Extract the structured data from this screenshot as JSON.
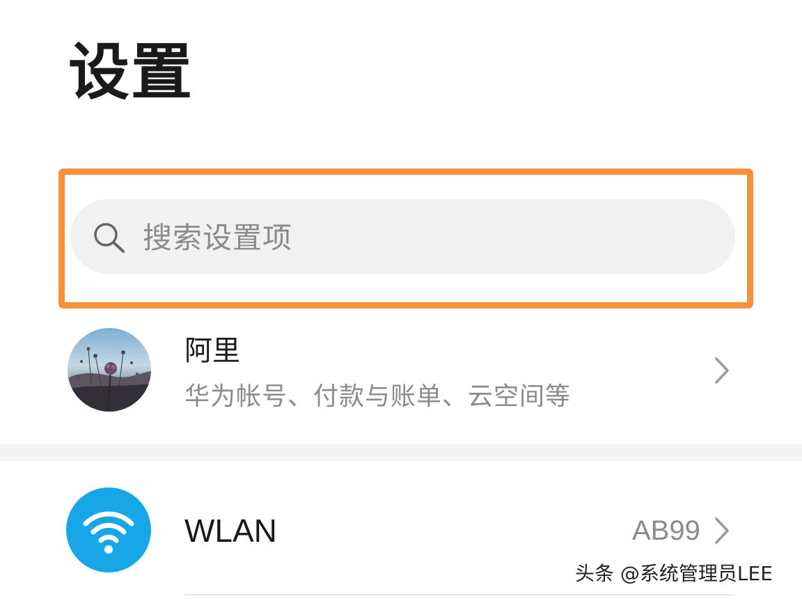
{
  "header": {
    "title": "设置"
  },
  "search": {
    "placeholder": "搜索设置项",
    "icon": "search-icon",
    "highlight_color": "#f79039"
  },
  "account": {
    "name": "阿里",
    "description": "华为帐号、付款与账单、云空间等",
    "avatar": "avatar-photo"
  },
  "wlan": {
    "label": "WLAN",
    "value": "AB99",
    "icon": "wifi-icon",
    "icon_color": "#17a7e8"
  },
  "watermark": {
    "text": "头条 @系统管理员LEE"
  }
}
